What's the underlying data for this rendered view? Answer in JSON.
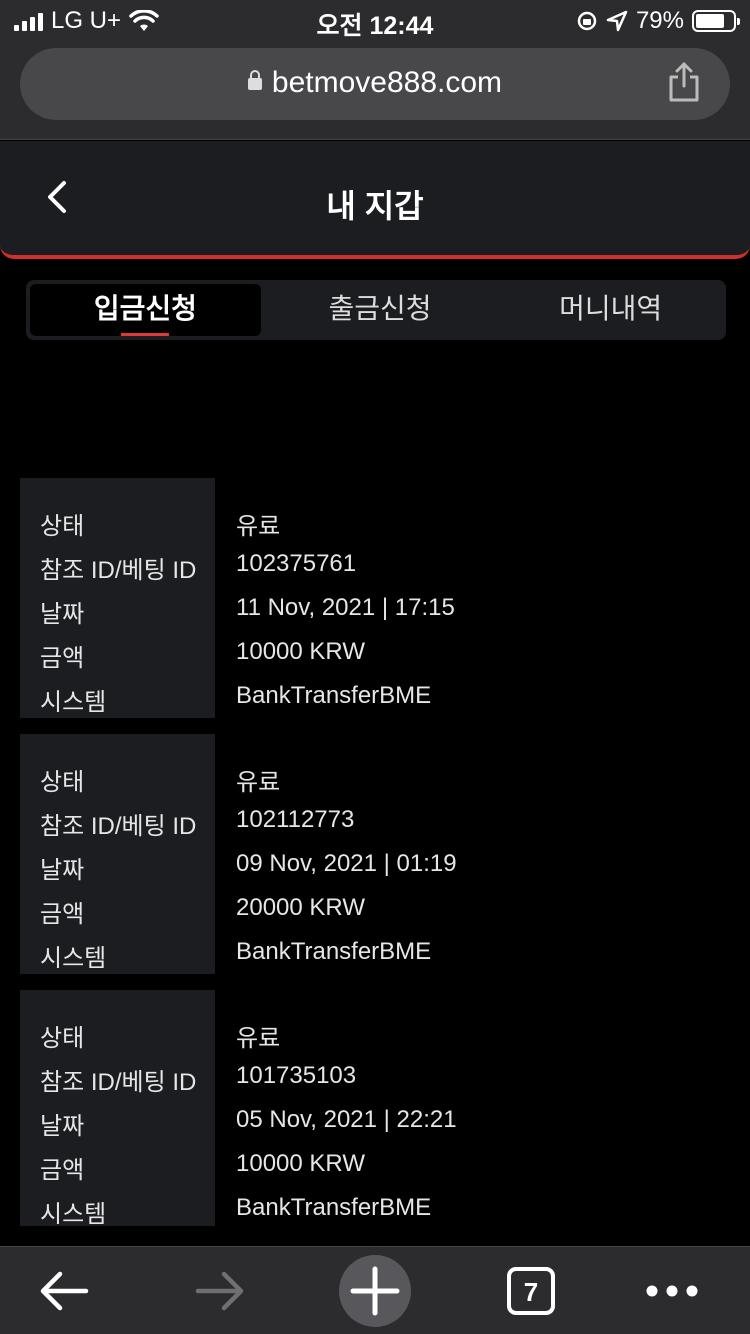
{
  "status_bar": {
    "carrier": "LG U+",
    "time": "오전 12:44",
    "battery": "79%",
    "battery_level": 0.79
  },
  "browser": {
    "url": "betmove888.com",
    "tabs_count": "7"
  },
  "header": {
    "title": "내 지갑"
  },
  "tabs": [
    {
      "label": "입금신청",
      "active": true
    },
    {
      "label": "출금신청",
      "active": false
    },
    {
      "label": "머니내역",
      "active": false
    }
  ],
  "record_labels": {
    "status": "상태",
    "ref_id": "참조 ID/베팅 ID",
    "date": "날짜",
    "amount": "금액",
    "system": "시스템"
  },
  "records": [
    {
      "status": "유료",
      "ref_id": "102375761",
      "date": "11 Nov, 2021 | 17:15",
      "amount": "10000 KRW",
      "system": "BankTransferBME"
    },
    {
      "status": "유료",
      "ref_id": "102112773",
      "date": "09 Nov, 2021 | 01:19",
      "amount": "20000 KRW",
      "system": "BankTransferBME"
    },
    {
      "status": "유료",
      "ref_id": "101735103",
      "date": "05 Nov, 2021 | 22:21",
      "amount": "10000 KRW",
      "system": "BankTransferBME"
    }
  ]
}
